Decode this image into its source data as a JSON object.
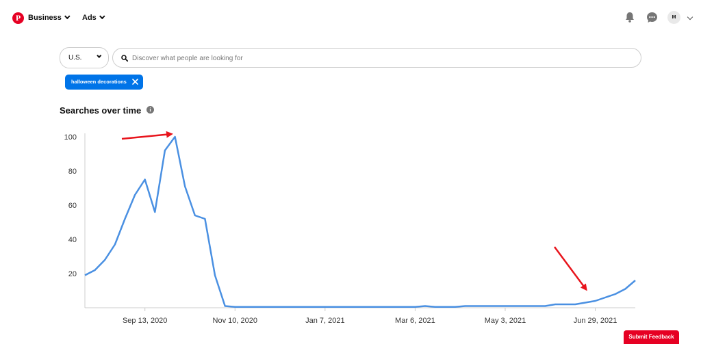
{
  "nav": {
    "business_label": "Business",
    "ads_label": "Ads",
    "avatar_initial": "M"
  },
  "filters": {
    "region": "U.S.",
    "search_placeholder": "Discover what people are looking for",
    "chip_label": "halloween decorations"
  },
  "section": {
    "title": "Searches over time",
    "info_icon": "i"
  },
  "colors": {
    "brand": "#e60023",
    "chip": "#0074e8",
    "line": "#4a90e2",
    "annotation_arrow": "#e8141c"
  },
  "chart_data": {
    "type": "line",
    "title": "Searches over time",
    "y_ticks": [
      "100",
      "80",
      "60",
      "40",
      "20"
    ],
    "y_tick_values": [
      100,
      80,
      60,
      40,
      20
    ],
    "ylim": [
      0,
      100
    ],
    "x_ticks": [
      "Sep 13, 2020",
      "Nov 10, 2020",
      "Jan 7, 2021",
      "Mar 6, 2021",
      "May 3, 2021",
      "Jun 29, 2021"
    ],
    "x_tick_index": [
      6,
      15,
      24,
      33,
      42,
      51
    ],
    "grid": false,
    "series": [
      {
        "values": [
          19,
          22,
          28,
          37,
          52,
          66,
          75,
          56,
          92,
          100,
          71,
          54,
          52,
          19,
          1,
          0.5,
          0.5,
          0.5,
          0.5,
          0.5,
          0.5,
          0.5,
          0.5,
          0.5,
          0.5,
          0.5,
          0.5,
          0.5,
          0.5,
          0.5,
          0.5,
          0.5,
          0.5,
          0.5,
          1,
          0.5,
          0.5,
          0.5,
          1,
          1,
          1,
          1,
          1,
          1,
          1,
          1,
          1,
          2,
          2,
          2,
          3,
          4,
          6,
          8,
          11,
          16
        ]
      }
    ]
  },
  "footer": {
    "feedback_label": "Submit Feedback"
  }
}
